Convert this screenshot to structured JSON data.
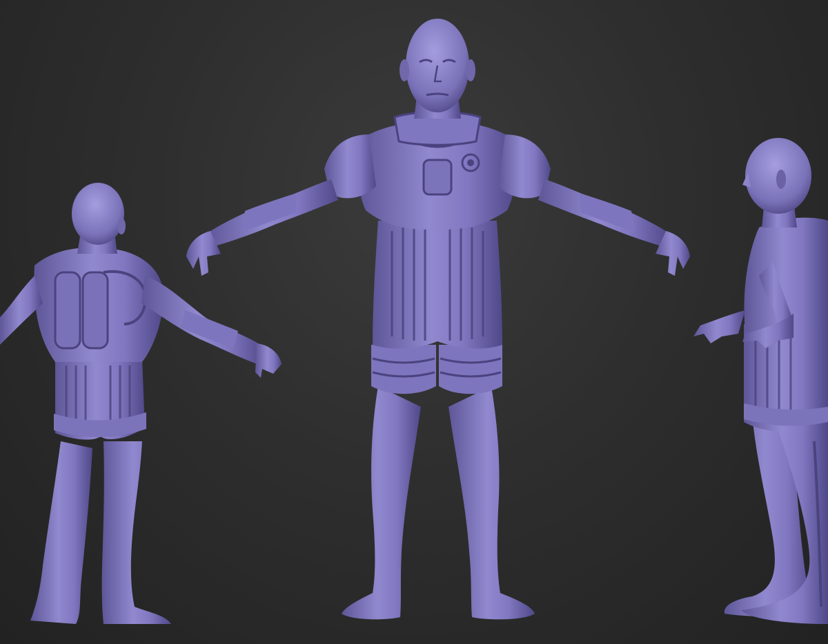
{
  "scene": {
    "description_visible_text": "",
    "background_color": "#2c2c2c",
    "material_color": "#8a82c4",
    "material_shadow": "#4e4785",
    "material_highlight": "#b3acea"
  },
  "figures": [
    {
      "view": "back"
    },
    {
      "view": "front"
    },
    {
      "view": "side"
    }
  ]
}
